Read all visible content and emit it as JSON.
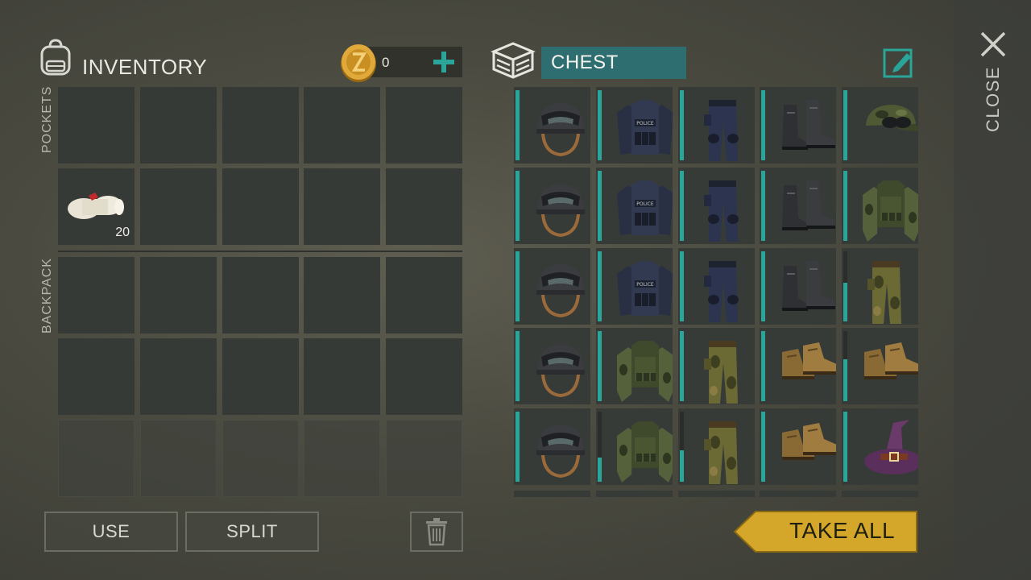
{
  "inventory": {
    "title": "INVENTORY",
    "currency": {
      "value": "0",
      "coin_icon": "coin-icon",
      "add_icon": "plus-icon"
    },
    "sections": {
      "pockets": "POCKETS",
      "backpack": "BACKPACK"
    },
    "pocket_items": [
      {
        "slot": 5,
        "icon": "bandage-icon",
        "quantity": "20"
      }
    ]
  },
  "buttons": {
    "use": "USE",
    "split": "SPLIT",
    "trash_icon": "trash-icon"
  },
  "chest": {
    "title": "CHEST",
    "edit_icon": "edit-icon",
    "rows": [
      [
        {
          "item": "tactical-helmet-icon",
          "fill": 1.0
        },
        {
          "item": "police-vest-icon",
          "fill": 1.0
        },
        {
          "item": "police-pants-icon",
          "fill": 1.0
        },
        {
          "item": "boots-icon",
          "fill": 1.0
        },
        {
          "item": "camo-cap-icon",
          "fill": 1.0
        }
      ],
      [
        {
          "item": "tactical-helmet-icon",
          "fill": 1.0
        },
        {
          "item": "police-vest-icon",
          "fill": 1.0
        },
        {
          "item": "police-pants-icon",
          "fill": 1.0
        },
        {
          "item": "boots-icon",
          "fill": 1.0
        },
        {
          "item": "camo-vest-icon",
          "fill": 1.0
        }
      ],
      [
        {
          "item": "tactical-helmet-icon",
          "fill": 1.0
        },
        {
          "item": "police-vest-icon",
          "fill": 1.0
        },
        {
          "item": "police-pants-icon",
          "fill": 1.0
        },
        {
          "item": "boots-icon",
          "fill": 1.0
        },
        {
          "item": "camo-pants-icon",
          "fill": 0.55
        }
      ],
      [
        {
          "item": "tactical-helmet-icon",
          "fill": 1.0
        },
        {
          "item": "camo-vest-icon",
          "fill": 1.0
        },
        {
          "item": "camo-pants-icon",
          "fill": 1.0
        },
        {
          "item": "leather-shoes-icon",
          "fill": 1.0
        },
        {
          "item": "leather-shoes-icon",
          "fill": 0.6
        }
      ],
      [
        {
          "item": "tactical-helmet-icon",
          "fill": 1.0
        },
        {
          "item": "camo-vest-icon",
          "fill": 0.35
        },
        {
          "item": "camo-pants-icon",
          "fill": 0.45
        },
        {
          "item": "leather-shoes-icon",
          "fill": 1.0
        },
        {
          "item": "witch-hat-icon",
          "fill": 1.0
        }
      ]
    ]
  },
  "actions": {
    "take_all": "TAKE ALL",
    "close": "CLOSE",
    "close_icon": "close-x-icon"
  },
  "colors": {
    "accent_teal": "#2aa59a",
    "take_all_yellow": "#d4a62a",
    "chest_title_bg": "#2f6e70"
  }
}
